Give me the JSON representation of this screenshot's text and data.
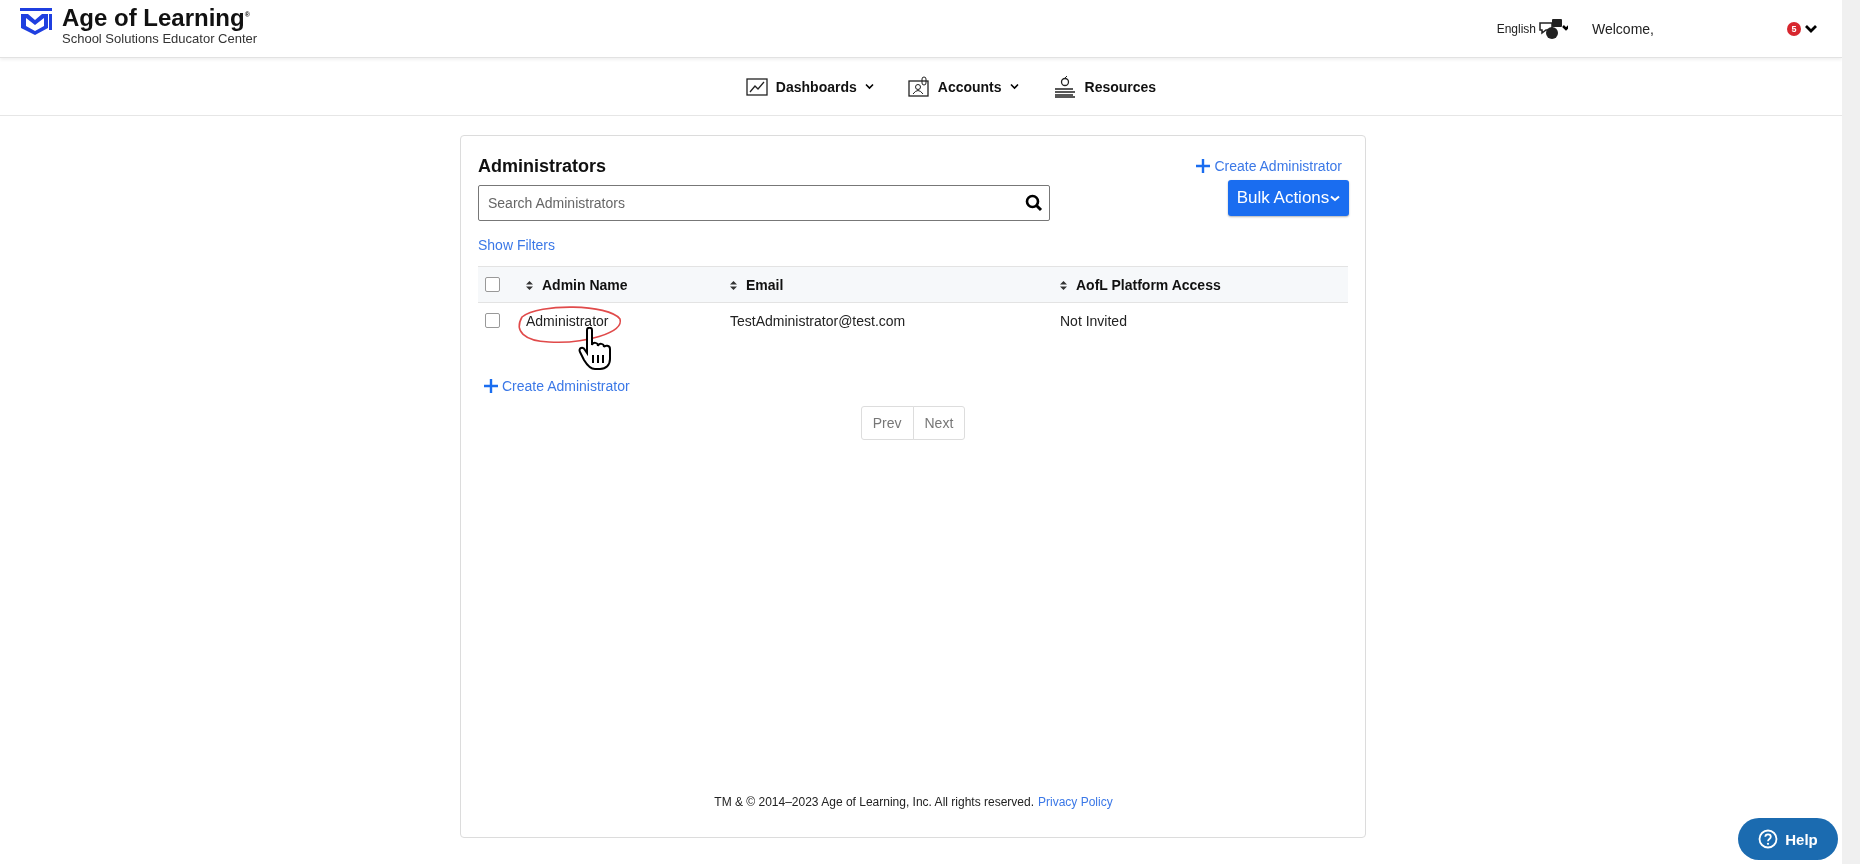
{
  "header": {
    "brand": "Age of Learning",
    "brand_mark": "®",
    "subtitle": "School Solutions Educator Center",
    "language": "English",
    "welcome": "Welcome,",
    "notification_count": "5"
  },
  "nav": [
    {
      "label": "Dashboards",
      "kind": "chart",
      "dropdown": true
    },
    {
      "label": "Accounts",
      "kind": "account",
      "dropdown": true
    },
    {
      "label": "Resources",
      "kind": "books",
      "dropdown": false
    }
  ],
  "page": {
    "title": "Administrators",
    "create_link": "Create Administrator",
    "search": {
      "placeholder": "Search Administrators"
    },
    "bulk_button": "Bulk Actions",
    "show_filters": "Show Filters"
  },
  "table": {
    "select_all_checked": false,
    "columns": [
      "Admin Name",
      "Email",
      "AofL Platform Access"
    ],
    "rows": [
      {
        "cells": [
          "Administrator",
          "TestAdministrator@test.com",
          "Not Invited"
        ],
        "checked": false
      }
    ]
  },
  "bottom_create_link": "Create Administrator",
  "pagination": [
    "Prev",
    "Next"
  ],
  "footer": {
    "text": "TM & © 2014–2023 Age of Learning, Inc. All rights reserved.",
    "link": "Privacy Policy"
  },
  "help_button": "Help"
}
